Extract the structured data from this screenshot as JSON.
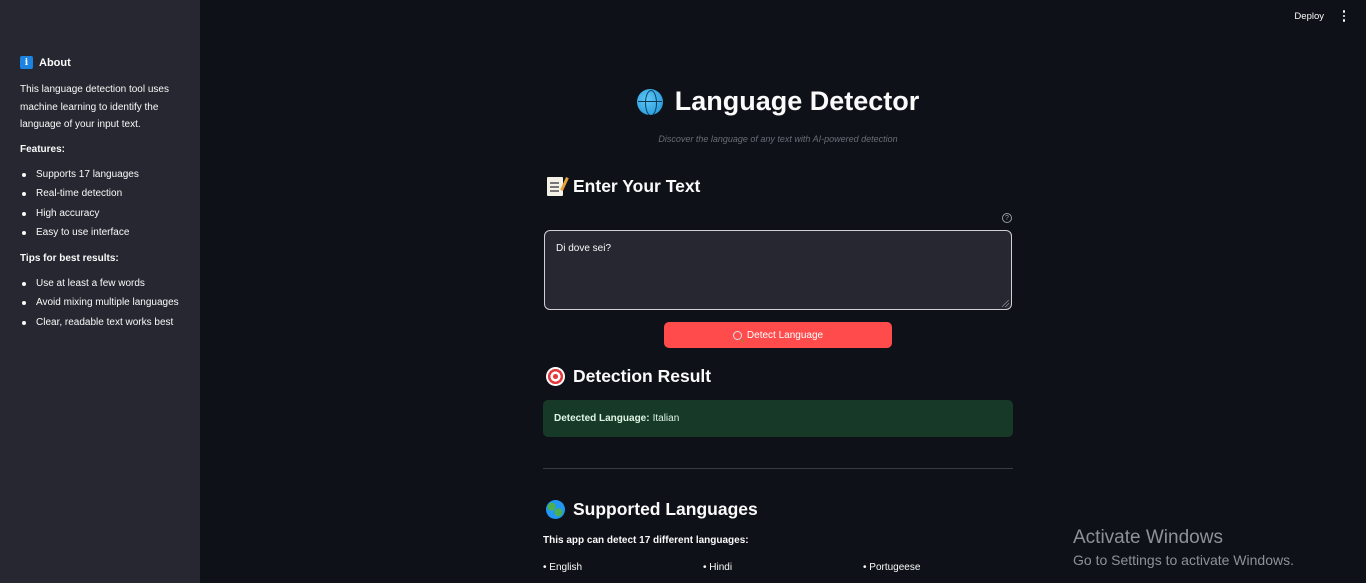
{
  "sidebar": {
    "about_title": "About",
    "about_icon": "i",
    "description": "This language detection tool uses machine learning to identify the language of your input text.",
    "features_heading": "Features:",
    "features": [
      "Supports 17 languages",
      "Real-time detection",
      "High accuracy",
      "Easy to use interface"
    ],
    "tips_heading": "Tips for best results:",
    "tips": [
      "Use at least a few words",
      "Avoid mixing multiple languages",
      "Clear, readable text works best"
    ]
  },
  "topbar": {
    "deploy_label": "Deploy"
  },
  "header": {
    "title": "Language Detector",
    "subtitle": "Discover the language of any text with AI-powered detection"
  },
  "input_section": {
    "heading": "Enter Your Text",
    "help_icon": "?",
    "text_value": "Di dove sei?",
    "button_label": "Detect Language"
  },
  "result_section": {
    "heading": "Detection Result",
    "result_label": "Detected Language:",
    "result_value": "Italian"
  },
  "languages_section": {
    "heading": "Supported Languages",
    "intro": "This app can detect 17 different languages:",
    "visible_languages": [
      "• English",
      "• Hindi",
      "• Portugeese"
    ]
  },
  "watermark": {
    "line1": "Activate Windows",
    "line2": "Go to Settings to activate Windows."
  },
  "colors": {
    "background": "#0e1117",
    "sidebar": "#262730",
    "primary_button": "#ff4b4b",
    "success_bg": "#173928"
  }
}
